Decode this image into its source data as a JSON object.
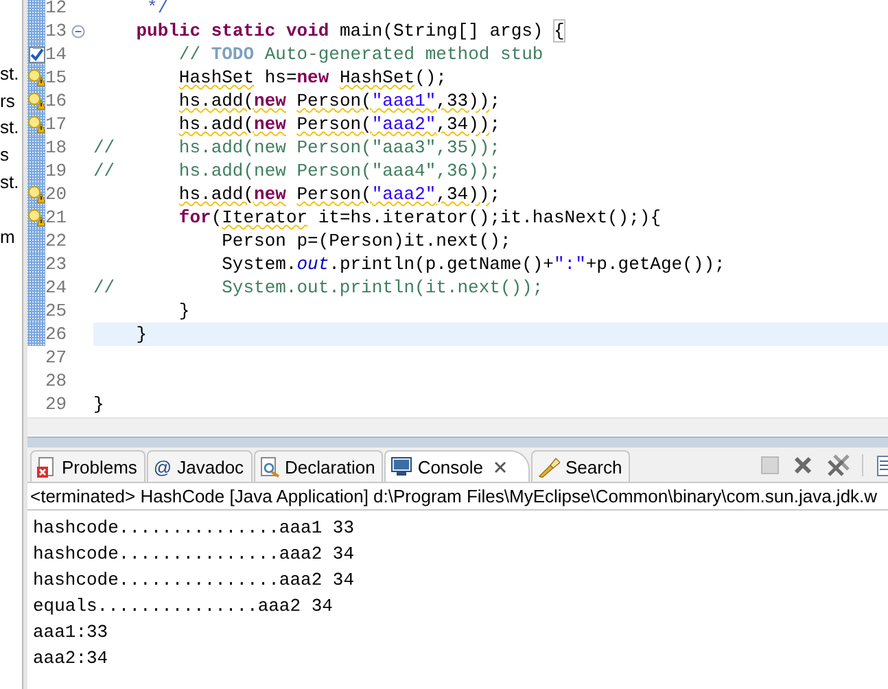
{
  "side_panel": {
    "items": [
      {
        "text": "st."
      },
      {
        "text": "rs"
      },
      {
        "text": "st."
      },
      {
        "text": "s"
      },
      {
        "text": "st."
      },
      {
        "text": "m"
      }
    ]
  },
  "editor": {
    "lines": [
      {
        "number": "12",
        "task": false,
        "warning": false,
        "foldable": false,
        "in_range": true,
        "current": false,
        "tokens": [
          {
            "text": "     */",
            "kind": "javadoc",
            "warning": false
          }
        ]
      },
      {
        "number": "13",
        "task": false,
        "warning": false,
        "foldable": true,
        "in_range": true,
        "current": false,
        "tokens": [
          {
            "text": "    public",
            "kind": "keyword",
            "warning": false
          },
          {
            "text": " static",
            "kind": "keyword",
            "warning": false
          },
          {
            "text": " void",
            "kind": "keyword",
            "warning": false
          },
          {
            "text": " main(String[] args) ",
            "kind": "plain",
            "warning": false
          },
          {
            "text": "{",
            "kind": "bracket",
            "warning": false
          }
        ]
      },
      {
        "number": "14",
        "task": true,
        "warning": false,
        "foldable": false,
        "in_range": true,
        "current": false,
        "tokens": [
          {
            "text": "        // ",
            "kind": "comment",
            "warning": false
          },
          {
            "text": "TODO",
            "kind": "todo",
            "warning": false
          },
          {
            "text": " Auto-generated method stub",
            "kind": "comment",
            "warning": false
          }
        ]
      },
      {
        "number": "15",
        "task": false,
        "warning": true,
        "foldable": false,
        "in_range": true,
        "current": false,
        "tokens": [
          {
            "text": "        HashSet",
            "kind": "plain",
            "warning": true
          },
          {
            "text": " hs=",
            "kind": "plain",
            "warning": false
          },
          {
            "text": "new",
            "kind": "keyword",
            "warning": false
          },
          {
            "text": " HashSet",
            "kind": "plain",
            "warning": true
          },
          {
            "text": "();",
            "kind": "plain",
            "warning": false
          }
        ]
      },
      {
        "number": "16",
        "task": false,
        "warning": true,
        "foldable": false,
        "in_range": true,
        "current": false,
        "tokens": [
          {
            "text": "        hs.add(",
            "kind": "plain",
            "warning": true
          },
          {
            "text": "new",
            "kind": "keyword",
            "warning": true
          },
          {
            "text": " Person(",
            "kind": "plain",
            "warning": true
          },
          {
            "text": "\"aaa1\"",
            "kind": "string",
            "warning": true
          },
          {
            "text": ",33))",
            "kind": "plain",
            "warning": true
          },
          {
            "text": ";",
            "kind": "plain",
            "warning": false
          }
        ]
      },
      {
        "number": "17",
        "task": false,
        "warning": true,
        "foldable": false,
        "in_range": true,
        "current": false,
        "tokens": [
          {
            "text": "        hs.add(",
            "kind": "plain",
            "warning": true
          },
          {
            "text": "new",
            "kind": "keyword",
            "warning": true
          },
          {
            "text": " Person(",
            "kind": "plain",
            "warning": true
          },
          {
            "text": "\"aaa2\"",
            "kind": "string",
            "warning": true
          },
          {
            "text": ",34))",
            "kind": "plain",
            "warning": true
          },
          {
            "text": ";",
            "kind": "plain",
            "warning": false
          }
        ]
      },
      {
        "number": "18",
        "task": false,
        "warning": false,
        "foldable": false,
        "in_range": true,
        "current": false,
        "tokens": [
          {
            "text": "//      hs.add(new Person(\"aaa3\",35));",
            "kind": "comment",
            "warning": false
          }
        ]
      },
      {
        "number": "19",
        "task": false,
        "warning": false,
        "foldable": false,
        "in_range": true,
        "current": false,
        "tokens": [
          {
            "text": "//      hs.add(new Person(\"aaa4\",36));",
            "kind": "comment",
            "warning": false
          }
        ]
      },
      {
        "number": "20",
        "task": false,
        "warning": true,
        "foldable": false,
        "in_range": true,
        "current": false,
        "tokens": [
          {
            "text": "        hs.add(",
            "kind": "plain",
            "warning": true
          },
          {
            "text": "new",
            "kind": "keyword",
            "warning": true
          },
          {
            "text": " Person(",
            "kind": "plain",
            "warning": true
          },
          {
            "text": "\"aaa2\"",
            "kind": "string",
            "warning": true
          },
          {
            "text": ",34))",
            "kind": "plain",
            "warning": true
          },
          {
            "text": ";",
            "kind": "plain",
            "warning": false
          }
        ]
      },
      {
        "number": "21",
        "task": false,
        "warning": true,
        "foldable": false,
        "in_range": true,
        "current": false,
        "tokens": [
          {
            "text": "        for",
            "kind": "keyword",
            "warning": false
          },
          {
            "text": "(",
            "kind": "plain",
            "warning": false
          },
          {
            "text": "Iterator",
            "kind": "plain",
            "warning": true
          },
          {
            "text": " it=hs.iterator();it.hasNext();){",
            "kind": "plain",
            "warning": false
          }
        ]
      },
      {
        "number": "22",
        "task": false,
        "warning": false,
        "foldable": false,
        "in_range": true,
        "current": false,
        "tokens": [
          {
            "text": "            Person p=(Person)it.next();",
            "kind": "plain",
            "warning": false
          }
        ]
      },
      {
        "number": "23",
        "task": false,
        "warning": false,
        "foldable": false,
        "in_range": true,
        "current": false,
        "tokens": [
          {
            "text": "            System.",
            "kind": "plain",
            "warning": false
          },
          {
            "text": "out",
            "kind": "field",
            "warning": false
          },
          {
            "text": ".println(p.getName()+",
            "kind": "plain",
            "warning": false
          },
          {
            "text": "\":\"",
            "kind": "string",
            "warning": false
          },
          {
            "text": "+p.getAge());",
            "kind": "plain",
            "warning": false
          }
        ]
      },
      {
        "number": "24",
        "task": false,
        "warning": false,
        "foldable": false,
        "in_range": true,
        "current": false,
        "tokens": [
          {
            "text": "//          System.out.println(it.next());",
            "kind": "comment",
            "warning": false
          }
        ]
      },
      {
        "number": "25",
        "task": false,
        "warning": false,
        "foldable": false,
        "in_range": true,
        "current": false,
        "tokens": [
          {
            "text": "        }",
            "kind": "plain",
            "warning": false
          }
        ]
      },
      {
        "number": "26",
        "task": false,
        "warning": false,
        "foldable": false,
        "in_range": true,
        "current": true,
        "tokens": [
          {
            "text": "    }",
            "kind": "plain",
            "warning": false
          }
        ]
      },
      {
        "number": "27",
        "task": false,
        "warning": false,
        "foldable": false,
        "in_range": false,
        "current": false
      },
      {
        "number": "28",
        "task": false,
        "warning": false,
        "foldable": false,
        "in_range": false,
        "current": false
      },
      {
        "number": "29",
        "task": false,
        "warning": false,
        "foldable": false,
        "in_range": false,
        "current": false,
        "tokens": [
          {
            "text": "}",
            "kind": "plain",
            "warning": false
          }
        ]
      }
    ]
  },
  "bottom_panel": {
    "tabs": [
      {
        "label": "Problems",
        "selected": false
      },
      {
        "label": "Javadoc",
        "icon_text": "@",
        "selected": false
      },
      {
        "label": "Declaration",
        "selected": false
      },
      {
        "label": "Console",
        "selected": true
      },
      {
        "label": "Search",
        "selected": false
      }
    ],
    "toolbar": [
      {
        "disabled": true
      },
      {
        "disabled": false
      },
      {
        "disabled": false
      },
      {
        "disabled": false
      }
    ],
    "console_header": "<terminated> HashCode [Java Application] d:\\Program Files\\MyEclipse\\Common\\binary\\com.sun.java.jdk.w",
    "output": [
      "hashcode...............aaa1 33",
      "hashcode...............aaa2 34",
      "hashcode...............aaa2 34",
      "equals...............aaa2 34",
      "aaa1:33",
      "aaa2:34"
    ]
  }
}
